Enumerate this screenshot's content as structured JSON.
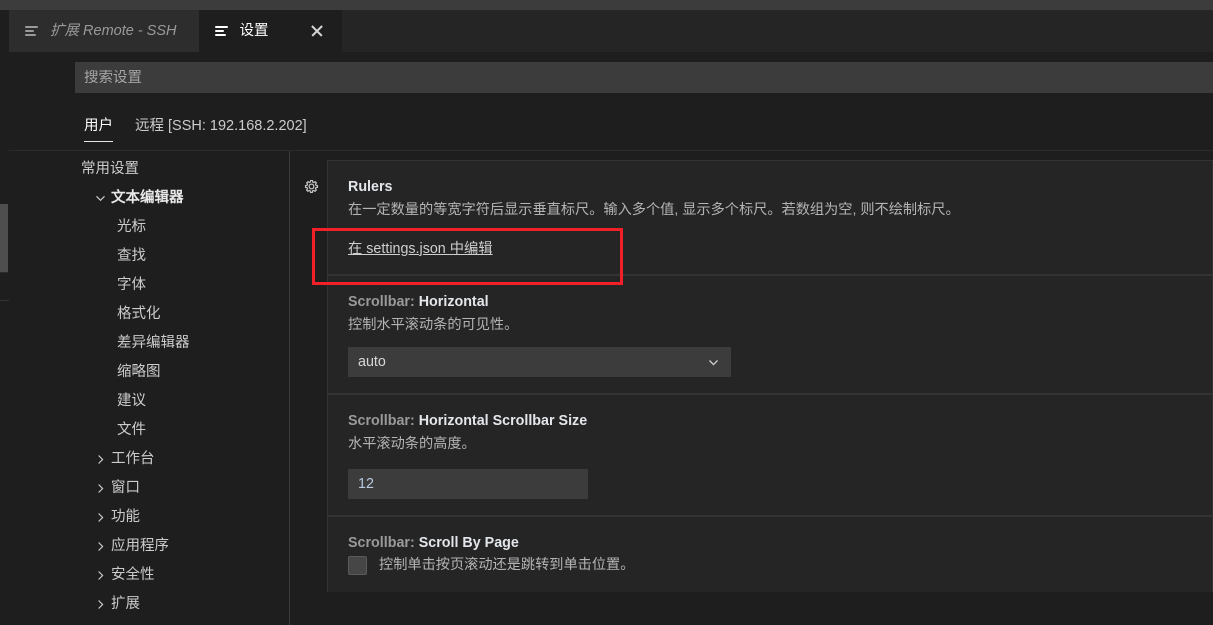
{
  "window": {
    "tabs": [
      {
        "label": "扩展 Remote - SSH",
        "icon": "list-icon",
        "active": false,
        "closable": false
      },
      {
        "label": "设置",
        "icon": "list-icon",
        "active": true,
        "closable": true
      }
    ]
  },
  "search": {
    "placeholder": "搜索设置",
    "value": ""
  },
  "scope_tabs": [
    {
      "label": "用户",
      "active": true
    },
    {
      "label": "远程 [SSH: 192.168.2.202]",
      "active": false
    }
  ],
  "toc": [
    {
      "label": "常用设置",
      "level": 0,
      "twisty": "none",
      "bold": false
    },
    {
      "label": "文本编辑器",
      "level": 0,
      "twisty": "down",
      "bold": true
    },
    {
      "label": "光标",
      "level": 1,
      "twisty": "none",
      "bold": false
    },
    {
      "label": "查找",
      "level": 1,
      "twisty": "none",
      "bold": false
    },
    {
      "label": "字体",
      "level": 1,
      "twisty": "none",
      "bold": false
    },
    {
      "label": "格式化",
      "level": 1,
      "twisty": "none",
      "bold": false
    },
    {
      "label": "差异编辑器",
      "level": 1,
      "twisty": "none",
      "bold": false
    },
    {
      "label": "缩略图",
      "level": 1,
      "twisty": "none",
      "bold": false
    },
    {
      "label": "建议",
      "level": 1,
      "twisty": "none",
      "bold": false
    },
    {
      "label": "文件",
      "level": 1,
      "twisty": "none",
      "bold": false
    },
    {
      "label": "工作台",
      "level": 0,
      "twisty": "right",
      "bold": false
    },
    {
      "label": "窗口",
      "level": 0,
      "twisty": "right",
      "bold": false
    },
    {
      "label": "功能",
      "level": 0,
      "twisty": "right",
      "bold": false
    },
    {
      "label": "应用程序",
      "level": 0,
      "twisty": "right",
      "bold": false
    },
    {
      "label": "安全性",
      "level": 0,
      "twisty": "right",
      "bold": false
    },
    {
      "label": "扩展",
      "level": 0,
      "twisty": "right",
      "bold": false
    }
  ],
  "settings": {
    "rulers": {
      "title": "Rulers",
      "title_prefix": "",
      "description": "在一定数量的等宽字符后显示垂直标尺。输入多个值, 显示多个标尺。若数组为空, 则不绘制标尺。",
      "edit_link": "在 settings.json 中编辑"
    },
    "scrollbar_horizontal": {
      "title_prefix": "Scrollbar: ",
      "title_key": "Horizontal",
      "description": "控制水平滚动条的可见性。",
      "value": "auto"
    },
    "scrollbar_horizontal_size": {
      "title_prefix": "Scrollbar: ",
      "title_key": "Horizontal Scrollbar Size",
      "description": "水平滚动条的高度。",
      "value": "12"
    },
    "scrollbar_scroll_by_page": {
      "title_prefix": "Scrollbar: ",
      "title_key": "Scroll By Page",
      "description": "控制单击按页滚动还是跳转到单击位置。",
      "checked": false
    }
  },
  "colors": {
    "highlight_box": "#f3202a",
    "editor_background": "#1e1e1e",
    "tabbar_background": "#252526",
    "input_background": "#3c3c3c",
    "setting_key": "#e3e6ea"
  }
}
